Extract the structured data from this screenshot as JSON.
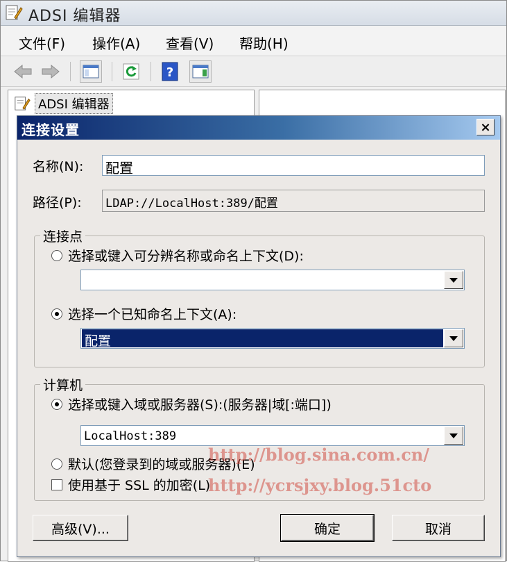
{
  "app": {
    "title": "ADSI 编辑器",
    "menu": [
      "文件(F)",
      "操作(A)",
      "查看(V)",
      "帮助(H)"
    ],
    "tree_root": "ADSI 编辑器"
  },
  "dialog": {
    "title": "连接设置",
    "close": "×",
    "name_label": "名称(N):",
    "name_value": "配置",
    "path_label": "路径(P):",
    "path_value": "LDAP://LocalHost:389/配置",
    "connection_point": {
      "legend": "连接点",
      "option_dn_label": "选择或键入可分辨名称或命名上下文(D):",
      "option_dn_value": "",
      "option_known_label": "选择一个已知命名上下文(A):",
      "option_known_value": "配置",
      "selected": "known"
    },
    "computer": {
      "legend": "计算机",
      "option_server_label": "选择或键入域或服务器(S):(服务器|域[:端口])",
      "option_server_value": "LocalHost:389",
      "option_default_label": "默认(您登录到的域或服务器)(E)",
      "ssl_label": "使用基于 SSL 的加密(L)",
      "ssl_checked": false,
      "selected": "server"
    },
    "buttons": {
      "advanced": "高级(V)...",
      "ok": "确定",
      "cancel": "取消"
    }
  },
  "watermarks": [
    "http://blog.sina.com.cn/",
    "http://ycrsjxy.blog.51cto"
  ],
  "colors": {
    "title_gradient_start": "#0a246a",
    "selection": "#0a246a",
    "watermark": "#d25046"
  }
}
